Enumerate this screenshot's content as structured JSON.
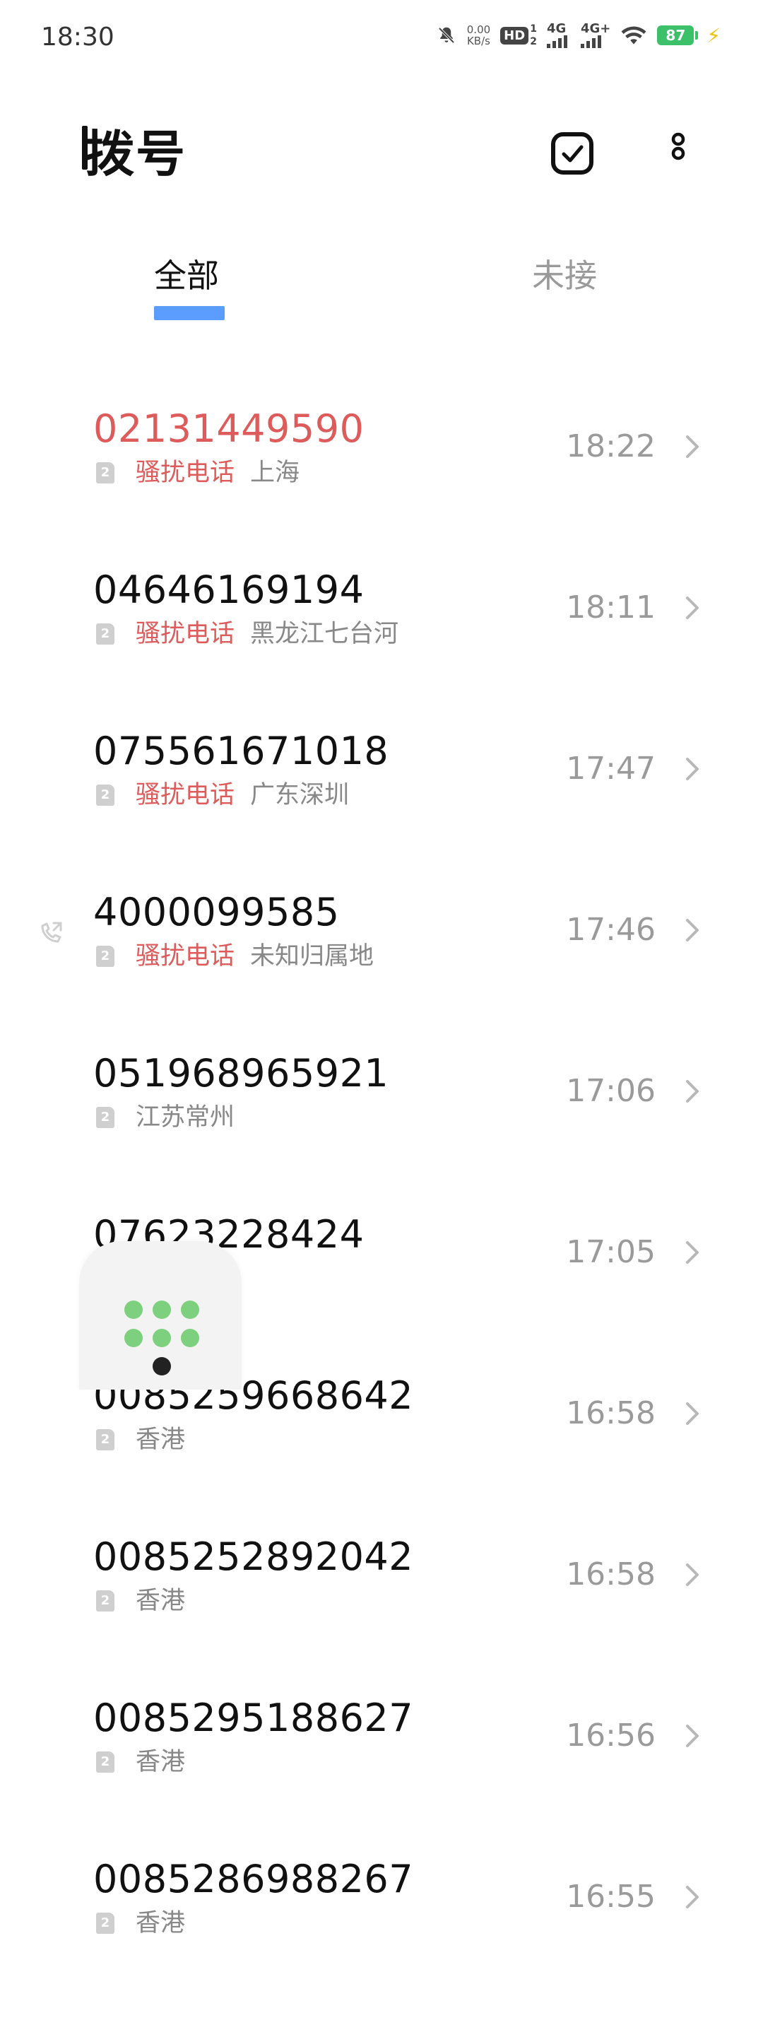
{
  "status_bar": {
    "time": "18:30",
    "net_speed_value": "0.00",
    "net_speed_unit": "KB/s",
    "hd_label": "HD",
    "sim1_net": "4G",
    "sim2_net": "4G+",
    "battery": "87",
    "sim_numbers": [
      "1",
      "2"
    ]
  },
  "header": {
    "title": "拨号"
  },
  "tabs": [
    {
      "label": "全部",
      "active": true
    },
    {
      "label": "未接",
      "active": false
    }
  ],
  "colors": {
    "accent": "#5b9dff",
    "spam": "#dd5b5b",
    "fab_green": "#7dd07d",
    "battery_green": "#3cc16a"
  },
  "calls": [
    {
      "number": "02131449590",
      "sim": "2",
      "tag": "骚扰电话",
      "location": "上海",
      "time": "18:22",
      "number_spam": true
    },
    {
      "number": "04646169194",
      "sim": "2",
      "tag": "骚扰电话",
      "location": "黑龙江七台河",
      "time": "18:11",
      "number_spam": false
    },
    {
      "number": "075561671018",
      "sim": "2",
      "tag": "骚扰电话",
      "location": "广东深圳",
      "time": "17:47",
      "number_spam": false
    },
    {
      "number": "4000099585",
      "sim": "2",
      "tag": "骚扰电话",
      "location": "未知归属地",
      "time": "17:46",
      "number_spam": false,
      "left_icon": "outgoing-call-icon"
    },
    {
      "number": "051968965921",
      "sim": "2",
      "tag": "",
      "location": "江苏常州",
      "time": "17:06",
      "number_spam": false
    },
    {
      "number": "07623228424",
      "sim": "2",
      "tag": "",
      "location": "",
      "time": "17:05",
      "number_spam": false
    },
    {
      "number": "0085259668642",
      "sim": "2",
      "tag": "",
      "location": "香港",
      "time": "16:58",
      "number_spam": false
    },
    {
      "number": "0085252892042",
      "sim": "2",
      "tag": "",
      "location": "香港",
      "time": "16:58",
      "number_spam": false
    },
    {
      "number": "0085295188627",
      "sim": "2",
      "tag": "",
      "location": "香港",
      "time": "16:56",
      "number_spam": false
    },
    {
      "number": "0085286988267",
      "sim": "2",
      "tag": "",
      "location": "香港",
      "time": "16:55",
      "number_spam": false
    }
  ],
  "icons": {
    "select": "checkbox-select-icon",
    "more": "more-vertical-icon",
    "chevron": "chevron-right-icon",
    "dialpad": "dialpad-icon",
    "sim": "sim-card-icon"
  }
}
